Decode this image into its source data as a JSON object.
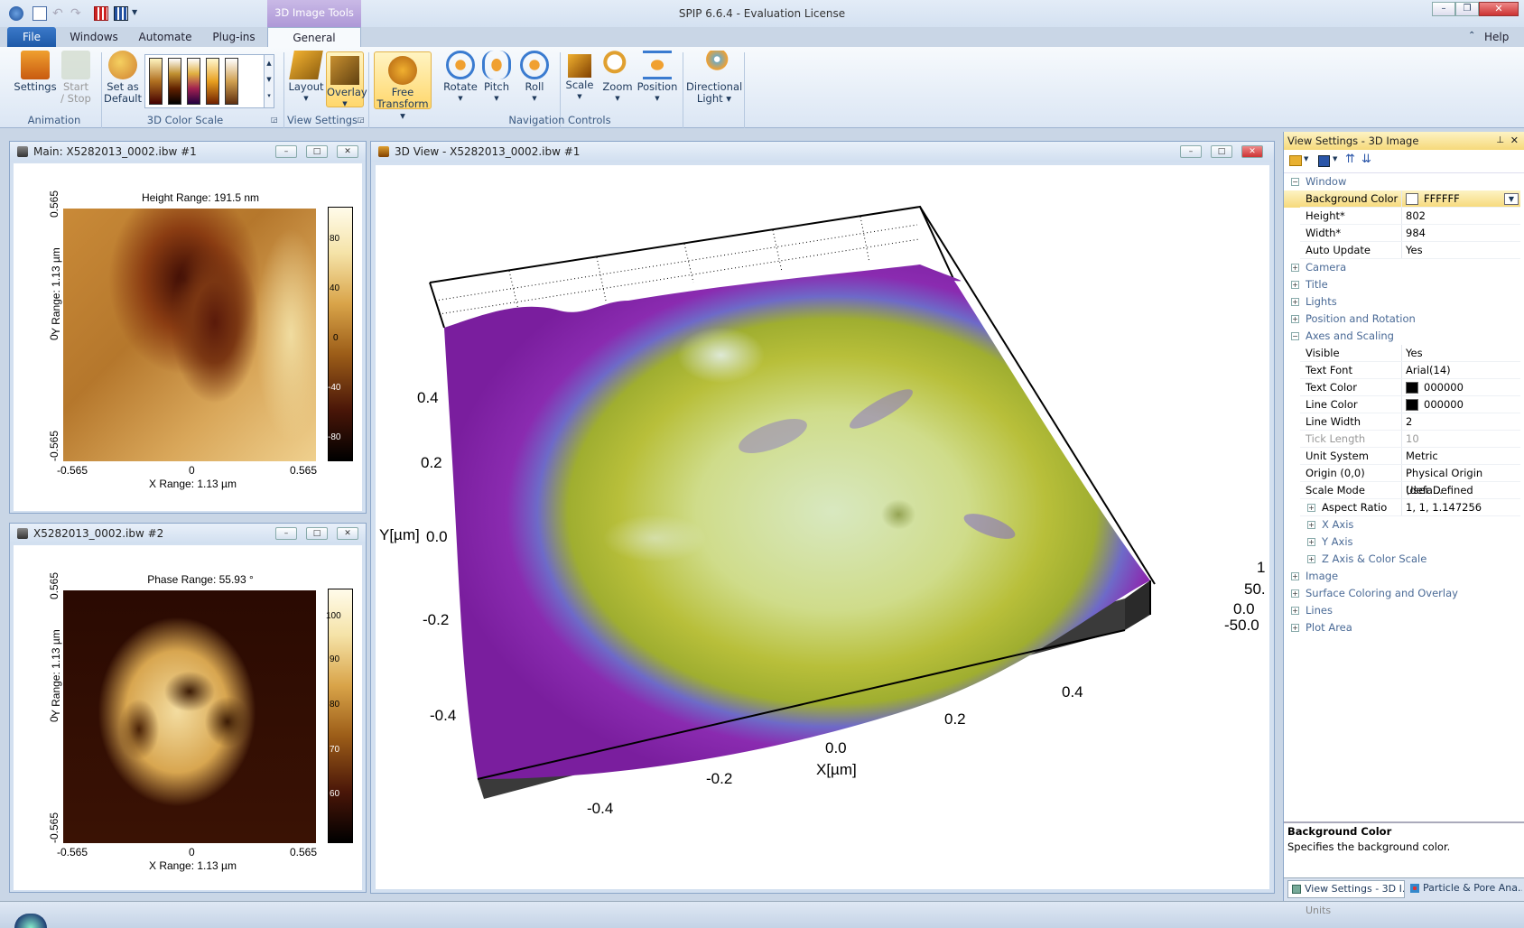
{
  "app": {
    "title": "SPIP 6.6.4 - Evaluation License",
    "help": "Help"
  },
  "tabs": {
    "file": "File",
    "windows": "Windows",
    "automate": "Automate",
    "plugins": "Plug-ins",
    "context": "3D Image Tools",
    "general": "General"
  },
  "ribbon": {
    "settings": "Settings",
    "start": "Start",
    "stop": "/ Stop",
    "set_as": "Set as",
    "default": "Default",
    "layout": "Layout",
    "overlay": "Overlay",
    "free": "Free",
    "transform": "Transform",
    "rotate": "Rotate",
    "pitch": "Pitch",
    "roll": "Roll",
    "scale": "Scale",
    "zoom": "Zoom",
    "position": "Position",
    "directional": "Directional",
    "light": "Light",
    "grp_animation": "Animation",
    "grp_colorscale": "3D Color Scale",
    "grp_viewsettings": "View Settings",
    "grp_navigation": "Navigation Controls"
  },
  "win_main": {
    "title": "Main: X5282013_0002.ibw #1",
    "range": "Height Range:  191.5 nm",
    "ylabel": "Y Range:  1.13 µm",
    "xlabel": "X Range:  1.13 µm",
    "ticks_x": [
      "-0.565",
      "0",
      "0.565"
    ],
    "ticks_y": [
      "0.565",
      "0",
      "-0.565"
    ],
    "cbar": [
      "80",
      "40",
      "0",
      "-40",
      "-80"
    ]
  },
  "win_phase": {
    "title": "X5282013_0002.ibw #2",
    "range": "Phase Range:  55.93 °",
    "ylabel": "Y Range:  1.13 µm",
    "xlabel": "X Range:  1.13 µm",
    "ticks_x": [
      "-0.565",
      "0",
      "0.565"
    ],
    "ticks_y": [
      "0.565",
      "0",
      "-0.565"
    ],
    "cbar": [
      "100",
      "90",
      "80",
      "70",
      "60"
    ]
  },
  "win_3d": {
    "title": "3D View - X5282013_0002.ibw #1",
    "ylabel": "Y[µm]",
    "xlabel": "X[µm]",
    "yticks": [
      "0.4",
      "0.2",
      "0.0",
      "-0.2",
      "-0.4"
    ],
    "xticks": [
      "-0.4",
      "-0.2",
      "0.0",
      "0.2",
      "0.4"
    ],
    "zticks": [
      "1",
      "50.",
      "0.0",
      "-50.0"
    ]
  },
  "view_settings": {
    "title": "View Settings - 3D Image",
    "rows": [
      {
        "type": "cat",
        "pm": "−",
        "k": "Window"
      },
      {
        "type": "prop",
        "k": "Background Color",
        "v": "FFFFFF",
        "swatch": "#ffffff",
        "selected": true
      },
      {
        "type": "prop",
        "k": "Height*",
        "v": "802"
      },
      {
        "type": "prop",
        "k": "Width*",
        "v": "984"
      },
      {
        "type": "prop",
        "k": "Auto Update",
        "v": "Yes"
      },
      {
        "type": "cat",
        "pm": "+",
        "k": "Camera"
      },
      {
        "type": "cat",
        "pm": "+",
        "k": "Title"
      },
      {
        "type": "cat",
        "pm": "+",
        "k": "Lights"
      },
      {
        "type": "cat",
        "pm": "+",
        "k": "Position and Rotation"
      },
      {
        "type": "cat",
        "pm": "−",
        "k": "Axes and Scaling"
      },
      {
        "type": "prop",
        "k": "Visible",
        "v": "Yes"
      },
      {
        "type": "prop",
        "k": "Text Font",
        "v": "Arial(14)"
      },
      {
        "type": "prop",
        "k": "Text Color",
        "v": "000000",
        "swatch": "#000000"
      },
      {
        "type": "prop",
        "k": "Line Color",
        "v": "000000",
        "swatch": "#000000"
      },
      {
        "type": "prop",
        "k": "Line Width",
        "v": "2"
      },
      {
        "type": "prop",
        "k": "Tick Length",
        "v": "10",
        "disabled": true
      },
      {
        "type": "prop",
        "k": "Unit System",
        "v": "Metric"
      },
      {
        "type": "prop",
        "k": "Origin (0,0)",
        "v": "Physical Origin (defa..."
      },
      {
        "type": "prop",
        "k": "Scale Mode",
        "v": "User Defined"
      },
      {
        "type": "sub",
        "pm": "+",
        "k": "Aspect Ratio",
        "v": "1, 1, 1.147256"
      },
      {
        "type": "subcat",
        "pm": "+",
        "k": "X Axis"
      },
      {
        "type": "subcat",
        "pm": "+",
        "k": "Y Axis"
      },
      {
        "type": "subcat",
        "pm": "+",
        "k": "Z Axis & Color Scale"
      },
      {
        "type": "cat",
        "pm": "+",
        "k": "Image"
      },
      {
        "type": "cat",
        "pm": "+",
        "k": "Surface Coloring and Overlay"
      },
      {
        "type": "cat",
        "pm": "+",
        "k": "Lines"
      },
      {
        "type": "cat",
        "pm": "+",
        "k": "Plot Area"
      }
    ],
    "desc_title": "Background Color",
    "desc_text": "Specifies the background color.",
    "tab1": "View Settings - 3D I...",
    "tab2": "Particle & Pore Ana...",
    "units": "Units"
  }
}
